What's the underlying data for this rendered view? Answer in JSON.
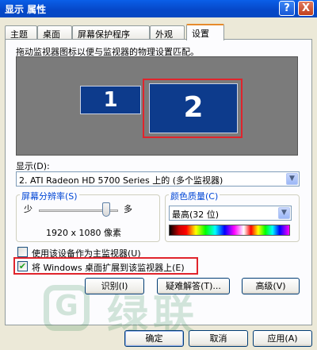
{
  "window": {
    "title": "显示 属性",
    "help_label": "?",
    "close_label": "X"
  },
  "tabs": [
    {
      "label": "主题"
    },
    {
      "label": "桌面"
    },
    {
      "label": "屏幕保护程序"
    },
    {
      "label": "外观"
    },
    {
      "label": "设置",
      "active": true
    }
  ],
  "settings": {
    "instruction": "拖动监视器图标以便与监视器的物理设置匹配。",
    "monitors": [
      {
        "number": "1",
        "selected": false
      },
      {
        "number": "2",
        "selected": true
      }
    ],
    "display_label": "显示(D):",
    "display_value": "2. ATI Radeon HD 5700 Series 上的 (多个监视器)",
    "resolution": {
      "group_label": "屏幕分辨率(S)",
      "less_label": "少",
      "more_label": "多",
      "value": "1920 x 1080 像素",
      "slider_level": 0.85
    },
    "color_quality": {
      "group_label": "颜色质量(C)",
      "value": "最高(32 位)"
    },
    "checkboxes": {
      "primary": {
        "label": "使用该设备作为主监视器(U)",
        "checked": false
      },
      "extend": {
        "label": "将 Windows 桌面扩展到该监视器上(E)",
        "checked": true
      }
    },
    "buttons": {
      "identify": "识别(I)",
      "troubleshoot": "疑难解答(T)...",
      "advanced": "高级(V)"
    }
  },
  "footer": {
    "ok": "确定",
    "cancel": "取消",
    "apply": "应用(A)"
  },
  "watermark": {
    "logo_letter": "G",
    "text": "绿联"
  },
  "colors": {
    "titlebar": "#0648c9",
    "monitor_fill": "#0d3b8c",
    "selection_highlight": "#e0242c",
    "group_label": "#0046d5"
  }
}
